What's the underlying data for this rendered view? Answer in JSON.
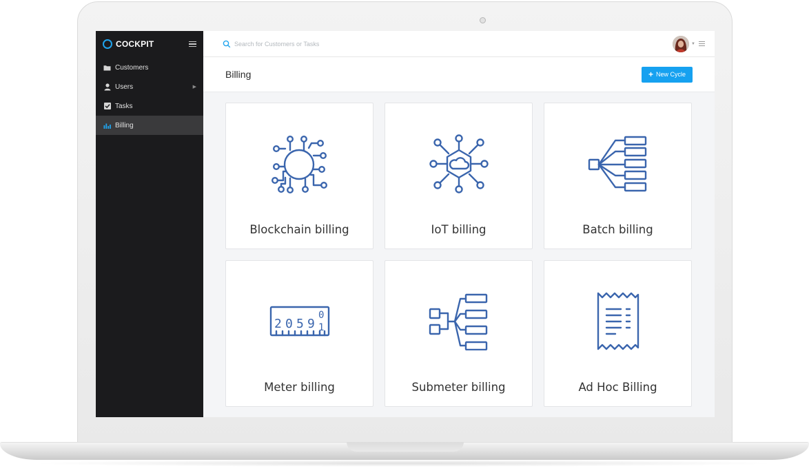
{
  "app": {
    "brand": "COCKPIT"
  },
  "sidebar": {
    "items": [
      {
        "label": "Customers",
        "icon": "folder-icon",
        "active": false
      },
      {
        "label": "Users",
        "icon": "user-icon",
        "active": false,
        "has_submenu": true
      },
      {
        "label": "Tasks",
        "icon": "checkbox-icon",
        "active": false
      },
      {
        "label": "Billing",
        "icon": "bar-chart-icon",
        "active": true
      }
    ]
  },
  "topbar": {
    "search_placeholder": "Search for Customers or Tasks"
  },
  "page": {
    "title": "Billing",
    "new_button_label": "New Cycle"
  },
  "cards": [
    {
      "label": "Blockchain billing",
      "icon": "blockchain-icon"
    },
    {
      "label": "IoT billing",
      "icon": "iot-icon"
    },
    {
      "label": "Batch billing",
      "icon": "batch-icon"
    },
    {
      "label": "Meter billing",
      "icon": "meter-icon",
      "meter_digits": [
        "2",
        "0",
        "5",
        "9"
      ],
      "meter_last_digits": [
        "0",
        "1"
      ]
    },
    {
      "label": "Submeter billing",
      "icon": "submeter-icon"
    },
    {
      "label": "Ad Hoc Billing",
      "icon": "receipt-icon"
    }
  ],
  "colors": {
    "accent": "#16a1f0",
    "icon_stroke": "#3a65ad",
    "sidebar_bg": "#1b1b1d"
  }
}
